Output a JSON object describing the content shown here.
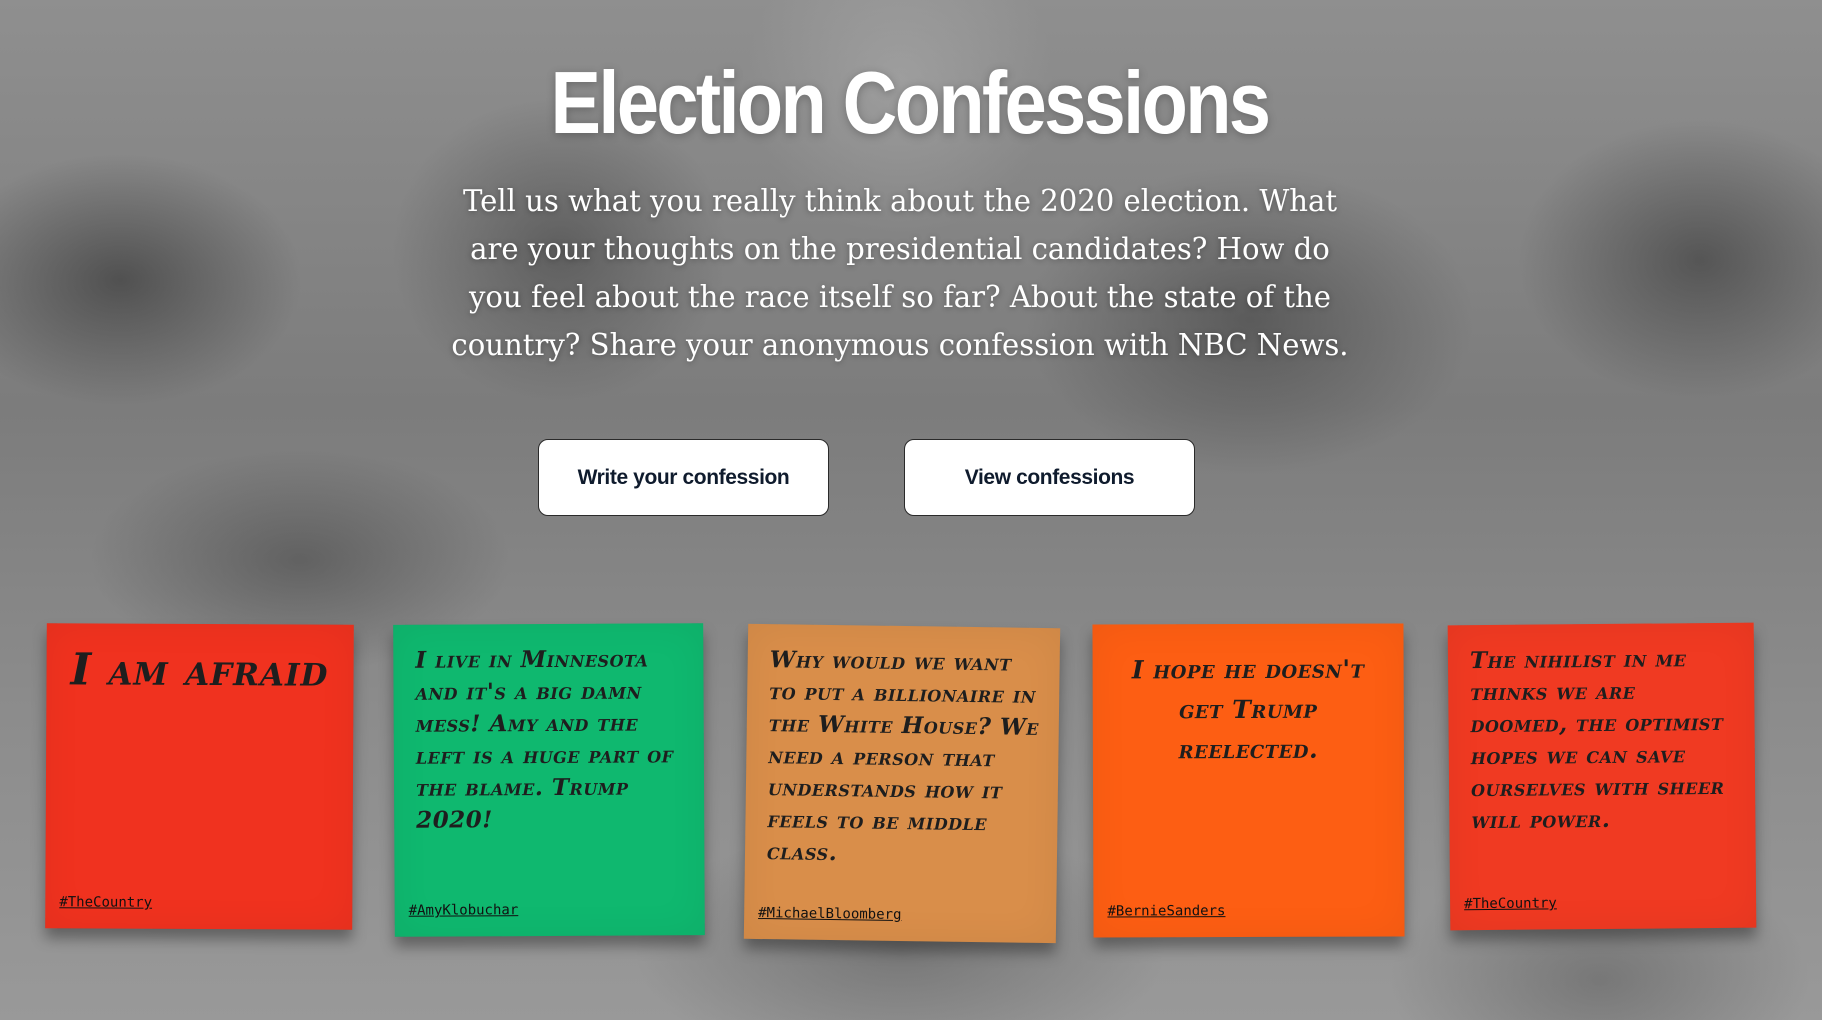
{
  "hero": {
    "title": "Election Confessions",
    "intro": "Tell us what you really think about the 2020 election. What are your thoughts on the presidential candidates? How do you feel about the race itself so far? About the state of the country? Share your anonymous confession with NBC News."
  },
  "buttons": {
    "write_label": "Write your confession",
    "view_label": "View confessions"
  },
  "notes": [
    {
      "text": "I am afraid",
      "tag": "#TheCountry",
      "color": "#f0321f"
    },
    {
      "text": "I live in Minnesota and it's a big damn mess! Amy and the left is a huge part of the blame. Trump 2020!",
      "tag": "#AmyKlobuchar",
      "color": "#0fb86f"
    },
    {
      "text": "Why would we want to put a billionaire in the White House? We need a person that understands how it feels to be middle class.",
      "tag": "#MichaelBloomberg",
      "color": "#d98e4a"
    },
    {
      "text": "I hope he doesn't get Trump reelected.",
      "tag": "#BernieSanders",
      "color": "#fd5e13"
    },
    {
      "text": "The nihilist in me thinks we are doomed, the optimist hopes we can save ourselves with sheer will power.",
      "tag": "#TheCountry",
      "color": "#f03a22"
    }
  ]
}
